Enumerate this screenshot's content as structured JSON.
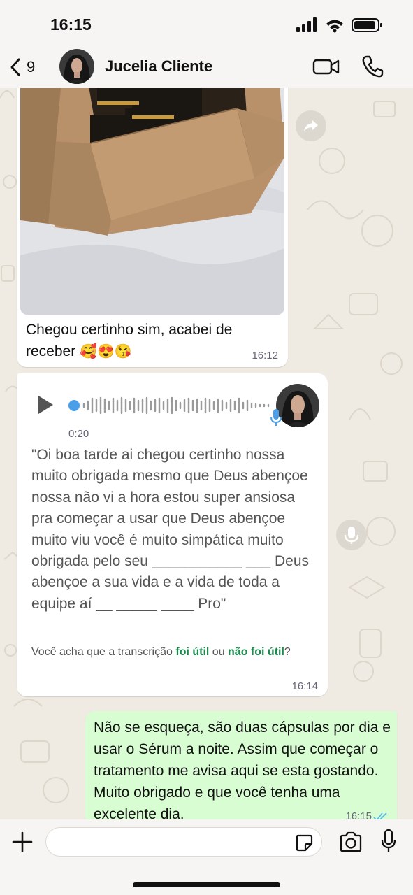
{
  "status_bar": {
    "time": "16:15"
  },
  "header": {
    "back_count": "9",
    "contact_name": "Jucelia Cliente"
  },
  "messages": {
    "photo_msg": {
      "caption": "Chegou certinho sim, acabei de receber",
      "emojis": "🥰😍😘",
      "time": "16:12"
    },
    "voice_msg": {
      "duration": "0:20",
      "transcript": "\"Oi boa tarde ai chegou certinho nossa muito obrigada mesmo que Deus abençoe nossa não vi a hora estou super ansiosa pra começar a usar que Deus abençoe muito viu você é muito simpática muito obrigada pelo seu ___________ ___ Deus abençoe a sua vida e a vida de toda a equipe aí __ _____ ____ Pro\"",
      "feedback_prefix": "Você acha que a transcrição ",
      "feedback_yes": "foi útil",
      "feedback_or": " ou ",
      "feedback_no": "não foi útil",
      "feedback_suffix": "?",
      "time": "16:14"
    },
    "outgoing_msg": {
      "text": "Não se esqueça, são duas cápsulas por dia e usar o Sérum a noite. Assim que começar o tratamento me avisa aqui se esta gostando. Muito obrigado e que você tenha uma excelente dia.",
      "time": "16:15"
    }
  },
  "composer": {
    "placeholder": ""
  },
  "colors": {
    "background": "#efeae2",
    "incoming": "#ffffff",
    "outgoing": "#d9fdd3",
    "accent": "#1b8a4d",
    "read_ticks": "#53bdeb"
  },
  "icons": [
    "back-chevron-icon",
    "video-camera-icon",
    "phone-icon",
    "forward-icon",
    "play-icon",
    "mic-icon",
    "plus-icon",
    "sticker-icon",
    "camera-icon",
    "double-check-icon"
  ]
}
